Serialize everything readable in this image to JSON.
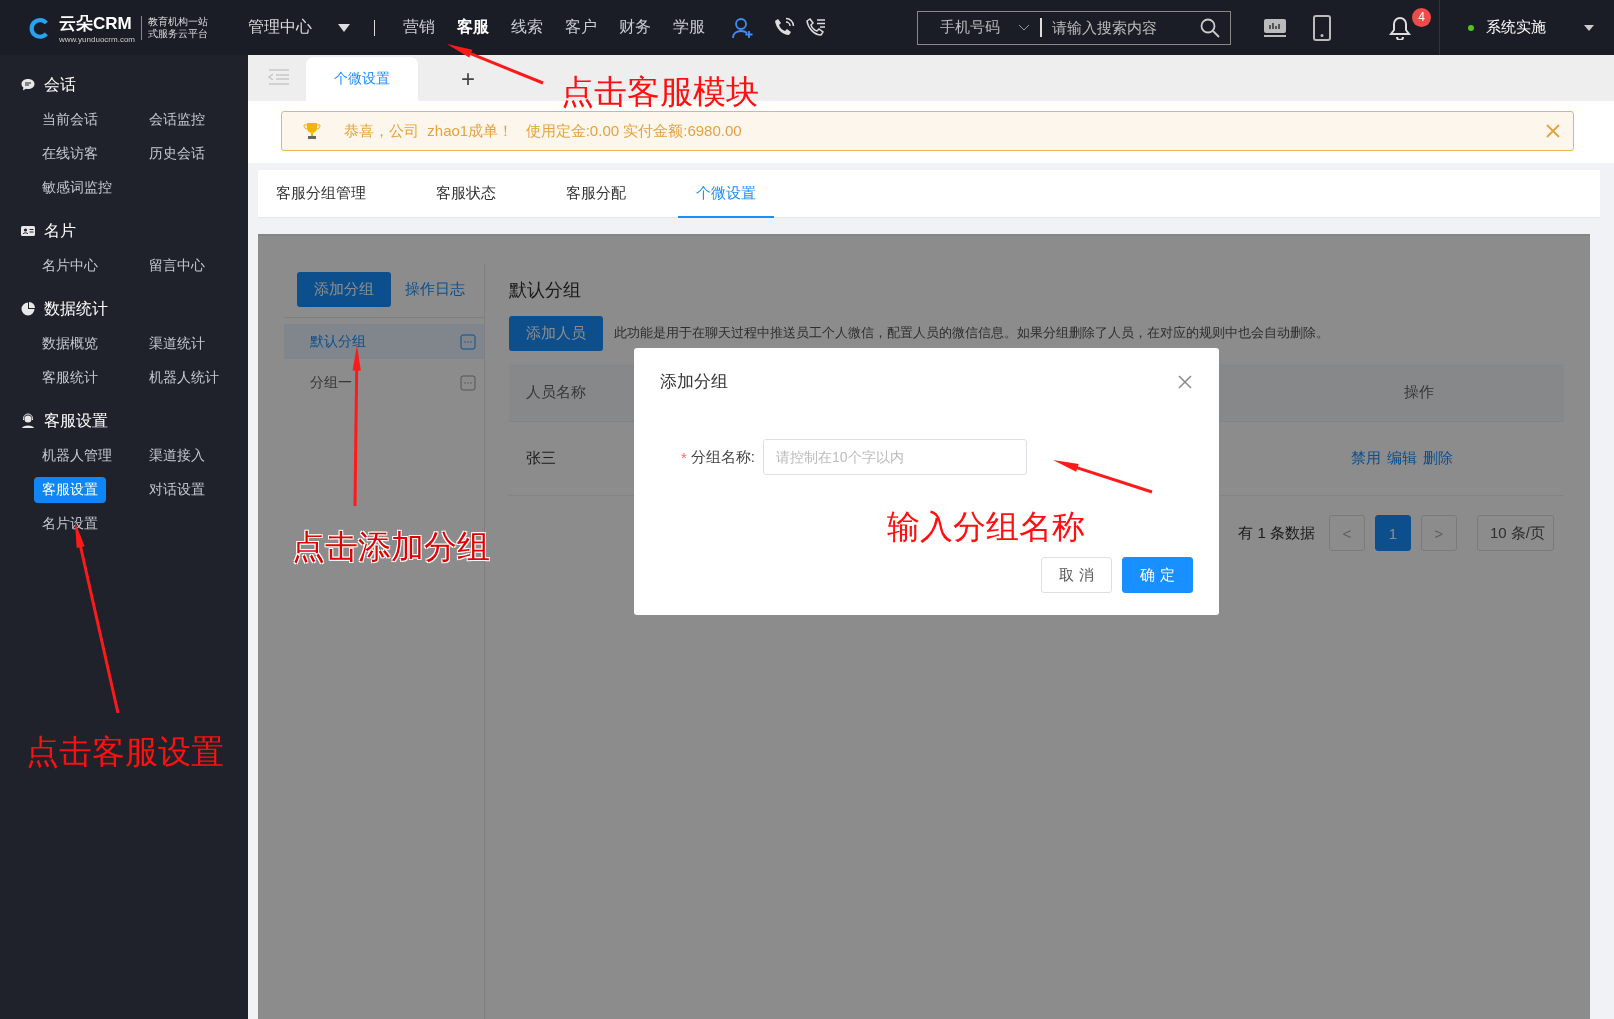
{
  "topbar": {
    "logo": {
      "name": "云朵CRM",
      "url": "www.yunduocrm.com",
      "tagline": [
        "教育机构一站",
        "式服务云平台"
      ]
    },
    "admin_menu": "管理中心",
    "nav": [
      {
        "label": "营销",
        "selected": false
      },
      {
        "label": "客服",
        "selected": true
      },
      {
        "label": "线索",
        "selected": false
      },
      {
        "label": "客户",
        "selected": false
      },
      {
        "label": "财务",
        "selected": false
      },
      {
        "label": "学服",
        "selected": false
      }
    ],
    "search": {
      "type": "手机号码",
      "placeholder": "请输入搜索内容"
    },
    "notification_count": "4",
    "user": "系统实施"
  },
  "sidebar": {
    "sections": [
      {
        "title": "会话",
        "items": [
          {
            "label": "当前会话",
            "selected": false
          },
          {
            "label": "会话监控",
            "selected": false
          },
          {
            "label": "在线访客",
            "selected": false
          },
          {
            "label": "历史会话",
            "selected": false
          },
          {
            "label": "敏感词监控",
            "selected": false
          }
        ]
      },
      {
        "title": "名片",
        "items": [
          {
            "label": "名片中心",
            "selected": false
          },
          {
            "label": "留言中心",
            "selected": false
          }
        ]
      },
      {
        "title": "数据统计",
        "items": [
          {
            "label": "数据概览",
            "selected": false
          },
          {
            "label": "渠道统计",
            "selected": false
          },
          {
            "label": "客服统计",
            "selected": false
          },
          {
            "label": "机器人统计",
            "selected": false
          }
        ]
      },
      {
        "title": "客服设置",
        "items": [
          {
            "label": "机器人管理",
            "selected": false
          },
          {
            "label": "渠道接入",
            "selected": false
          },
          {
            "label": "客服设置",
            "selected": true
          },
          {
            "label": "对话设置",
            "selected": false
          },
          {
            "label": "名片设置",
            "selected": false
          }
        ]
      }
    ]
  },
  "page_tabs": [
    {
      "label": "个微设置",
      "selected": true
    }
  ],
  "add_tab": "+",
  "notice": "恭喜，公司  zhao1成单！   使用定金:0.00 实付金额:6980.00",
  "sub_tabs": [
    {
      "label": "客服分组管理",
      "selected": false
    },
    {
      "label": "客服状态",
      "selected": false
    },
    {
      "label": "客服分配",
      "selected": false
    },
    {
      "label": "个微设置",
      "selected": true
    }
  ],
  "groups": {
    "add_button": "添加分组",
    "log_link": "操作日志",
    "items": [
      {
        "name": "默认分组",
        "selected": true
      },
      {
        "name": "分组一",
        "selected": false
      }
    ]
  },
  "detail": {
    "title": "默认分组",
    "add_button": "添加人员",
    "hint": "此功能是用于在聊天过程中推送员工个人微信，配置人员的微信信息。如果分组删除了人员，在对应的规则中也会自动删除。",
    "columns": [
      "人员名称",
      "操作"
    ],
    "rows": [
      {
        "name": "张三",
        "actions": [
          "禁用",
          "编辑",
          "删除"
        ]
      }
    ],
    "pagination": {
      "total": "有 1 条数据",
      "prev": "<",
      "pages": [
        {
          "label": "1",
          "selected": true
        }
      ],
      "next": ">",
      "page_size": "10 条/页"
    }
  },
  "modal": {
    "title": "添加分组",
    "field": {
      "label": "分组名称:",
      "required_mark": "*",
      "placeholder": "请控制在10个字以内"
    },
    "cancel": "取 消",
    "confirm": "确 定"
  },
  "annotations": [
    "点击客服模块",
    "点击添加分组",
    "输入分组名称",
    "点击客服设置"
  ]
}
